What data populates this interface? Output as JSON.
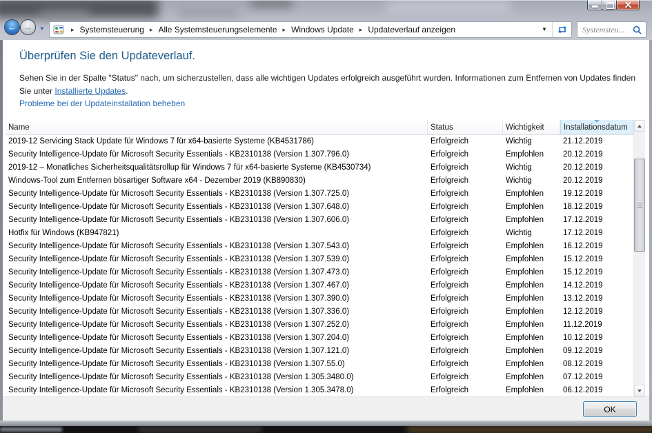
{
  "navbar": {
    "breadcrumb": [
      "Systemsteuerung",
      "Alle Systemsteuerungselemente",
      "Windows Update",
      "Updateverlauf anzeigen"
    ],
    "search": {
      "placeholder": "Systemsteu..."
    }
  },
  "content": {
    "title": "Überprüfen Sie den Updateverlauf.",
    "intro_text": "Sehen Sie in der Spalte \"Status\" nach, um sicherzustellen, dass alle wichtigen Updates erfolgreich ausgeführt wurden. Informationen zum Entfernen von Updates finden Sie unter ",
    "intro_link": "Installierte Updates",
    "intro_suffix": ".",
    "troubleshoot_link": "Probleme bei der Updateinstallation beheben"
  },
  "table": {
    "columns": [
      "Name",
      "Status",
      "Wichtigkeit",
      "Installationsdatum"
    ],
    "sort": {
      "column": "Installationsdatum",
      "direction": "desc"
    },
    "rows": [
      {
        "name": "2019-12 Servicing Stack Update für Windows 7 für x64-basierte Systeme (KB4531786)",
        "status": "Erfolgreich",
        "importance": "Wichtig",
        "date": "21.12.2019"
      },
      {
        "name": "Security Intelligence-Update für Microsoft Security Essentials - KB2310138 (Version 1.307.796.0)",
        "status": "Erfolgreich",
        "importance": "Empfohlen",
        "date": "20.12.2019"
      },
      {
        "name": "2019-12 – Monatliches Sicherheitsqualitätsrollup für Windows 7 für x64-basierte Systeme (KB4530734)",
        "status": "Erfolgreich",
        "importance": "Wichtig",
        "date": "20.12.2019"
      },
      {
        "name": "Windows-Tool zum Entfernen bösartiger Software x64 - Dezember 2019 (KB890830)",
        "status": "Erfolgreich",
        "importance": "Wichtig",
        "date": "20.12.2019"
      },
      {
        "name": "Security Intelligence-Update für Microsoft Security Essentials - KB2310138 (Version 1.307.725.0)",
        "status": "Erfolgreich",
        "importance": "Empfohlen",
        "date": "19.12.2019"
      },
      {
        "name": "Security Intelligence-Update für Microsoft Security Essentials - KB2310138 (Version 1.307.648.0)",
        "status": "Erfolgreich",
        "importance": "Empfohlen",
        "date": "18.12.2019"
      },
      {
        "name": "Security Intelligence-Update für Microsoft Security Essentials - KB2310138 (Version 1.307.606.0)",
        "status": "Erfolgreich",
        "importance": "Empfohlen",
        "date": "17.12.2019"
      },
      {
        "name": "Hotfix für Windows (KB947821)",
        "status": "Erfolgreich",
        "importance": "Wichtig",
        "date": "17.12.2019"
      },
      {
        "name": "Security Intelligence-Update für Microsoft Security Essentials - KB2310138 (Version 1.307.543.0)",
        "status": "Erfolgreich",
        "importance": "Empfohlen",
        "date": "16.12.2019"
      },
      {
        "name": "Security Intelligence-Update für Microsoft Security Essentials - KB2310138 (Version 1.307.539.0)",
        "status": "Erfolgreich",
        "importance": "Empfohlen",
        "date": "15.12.2019"
      },
      {
        "name": "Security Intelligence-Update für Microsoft Security Essentials - KB2310138 (Version 1.307.473.0)",
        "status": "Erfolgreich",
        "importance": "Empfohlen",
        "date": "15.12.2019"
      },
      {
        "name": "Security Intelligence-Update für Microsoft Security Essentials - KB2310138 (Version 1.307.467.0)",
        "status": "Erfolgreich",
        "importance": "Empfohlen",
        "date": "14.12.2019"
      },
      {
        "name": "Security Intelligence-Update für Microsoft Security Essentials - KB2310138 (Version 1.307.390.0)",
        "status": "Erfolgreich",
        "importance": "Empfohlen",
        "date": "13.12.2019"
      },
      {
        "name": "Security Intelligence-Update für Microsoft Security Essentials - KB2310138 (Version 1.307.336.0)",
        "status": "Erfolgreich",
        "importance": "Empfohlen",
        "date": "12.12.2019"
      },
      {
        "name": "Security Intelligence-Update für Microsoft Security Essentials - KB2310138 (Version 1.307.252.0)",
        "status": "Erfolgreich",
        "importance": "Empfohlen",
        "date": "11.12.2019"
      },
      {
        "name": "Security Intelligence-Update für Microsoft Security Essentials - KB2310138 (Version 1.307.204.0)",
        "status": "Erfolgreich",
        "importance": "Empfohlen",
        "date": "10.12.2019"
      },
      {
        "name": "Security Intelligence-Update für Microsoft Security Essentials - KB2310138 (Version 1.307.121.0)",
        "status": "Erfolgreich",
        "importance": "Empfohlen",
        "date": "09.12.2019"
      },
      {
        "name": "Security Intelligence-Update für Microsoft Security Essentials - KB2310138 (Version 1.307.55.0)",
        "status": "Erfolgreich",
        "importance": "Empfohlen",
        "date": "08.12.2019"
      },
      {
        "name": "Security Intelligence-Update für Microsoft Security Essentials - KB2310138 (Version 1.305.3480.0)",
        "status": "Erfolgreich",
        "importance": "Empfohlen",
        "date": "07.12.2019"
      },
      {
        "name": "Security Intelligence-Update für Microsoft Security Essentials - KB2310138 (Version 1.305.3478.0)",
        "status": "Erfolgreich",
        "importance": "Empfohlen",
        "date": "06.12.2019"
      }
    ]
  },
  "footer": {
    "ok_label": "OK"
  },
  "colors": {
    "title_blue": "#1c5a8a",
    "link_blue": "#2a6cb5",
    "sorted_header_bg": "#ddeffa",
    "close_red": "#bc4630"
  }
}
